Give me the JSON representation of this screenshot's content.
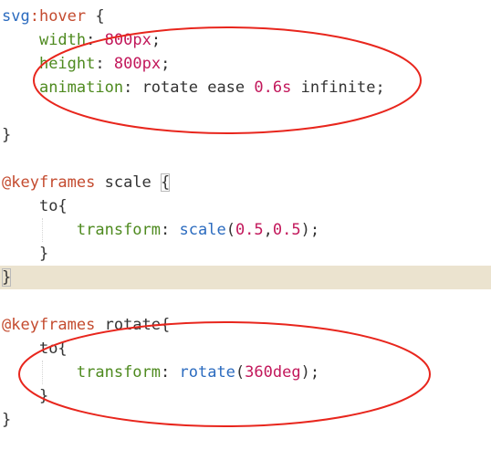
{
  "editor": {
    "lines": [
      {
        "tokens": [
          {
            "t": "svg",
            "c": "sel"
          },
          {
            "t": ":hover",
            "c": "pseudo"
          },
          {
            "t": " {",
            "c": "brace"
          }
        ]
      },
      {
        "tokens": [
          {
            "t": "    "
          },
          {
            "t": "width",
            "c": "prop"
          },
          {
            "t": ": ",
            "c": "punc"
          },
          {
            "t": "800",
            "c": "num"
          },
          {
            "t": "px",
            "c": "unit"
          },
          {
            "t": ";",
            "c": "punc"
          }
        ]
      },
      {
        "tokens": [
          {
            "t": "    "
          },
          {
            "t": "height",
            "c": "prop"
          },
          {
            "t": ": ",
            "c": "punc"
          },
          {
            "t": "800",
            "c": "num"
          },
          {
            "t": "px",
            "c": "unit"
          },
          {
            "t": ";",
            "c": "punc"
          }
        ]
      },
      {
        "tokens": [
          {
            "t": "    "
          },
          {
            "t": "animation",
            "c": "prop"
          },
          {
            "t": ": ",
            "c": "punc"
          },
          {
            "t": "rotate ease ",
            "c": "val"
          },
          {
            "t": "0.6",
            "c": "num"
          },
          {
            "t": "s",
            "c": "unit"
          },
          {
            "t": " infinite;",
            "c": "val"
          }
        ]
      },
      {
        "tokens": []
      },
      {
        "tokens": [
          {
            "t": "}",
            "c": "brace"
          }
        ]
      },
      {
        "tokens": []
      },
      {
        "tokens": [
          {
            "t": "@keyframes",
            "c": "at"
          },
          {
            "t": " scale ",
            "c": "ident"
          },
          {
            "t": "{",
            "c": "brace",
            "match": true
          }
        ]
      },
      {
        "tokens": [
          {
            "t": "    "
          },
          {
            "t": "to{",
            "c": "ident"
          }
        ]
      },
      {
        "tokens": [
          {
            "t": "        "
          },
          {
            "t": "transform",
            "c": "prop"
          },
          {
            "t": ": ",
            "c": "punc"
          },
          {
            "t": "scale",
            "c": "fn"
          },
          {
            "t": "(",
            "c": "punc"
          },
          {
            "t": "0.5",
            "c": "num"
          },
          {
            "t": ",",
            "c": "punc"
          },
          {
            "t": "0.5",
            "c": "num"
          },
          {
            "t": ");",
            "c": "punc"
          }
        ]
      },
      {
        "tokens": [
          {
            "t": "    "
          },
          {
            "t": "}",
            "c": "brace"
          }
        ]
      },
      {
        "tokens": [
          {
            "t": "}",
            "c": "brace",
            "match": true
          }
        ],
        "current": true
      },
      {
        "tokens": []
      },
      {
        "tokens": [
          {
            "t": "@keyframes",
            "c": "at"
          },
          {
            "t": " rotate{",
            "c": "ident"
          }
        ]
      },
      {
        "tokens": [
          {
            "t": "    "
          },
          {
            "t": "to{",
            "c": "ident"
          }
        ]
      },
      {
        "tokens": [
          {
            "t": "        "
          },
          {
            "t": "transform",
            "c": "prop"
          },
          {
            "t": ": ",
            "c": "punc"
          },
          {
            "t": "rotate",
            "c": "fn"
          },
          {
            "t": "(",
            "c": "punc"
          },
          {
            "t": "360",
            "c": "num"
          },
          {
            "t": "deg",
            "c": "unit"
          },
          {
            "t": ");",
            "c": "punc"
          }
        ]
      },
      {
        "tokens": [
          {
            "t": "    "
          },
          {
            "t": "}",
            "c": "brace"
          }
        ]
      },
      {
        "tokens": [
          {
            "t": "}",
            "c": "brace"
          }
        ]
      }
    ],
    "annotation_color": "#e8261d"
  }
}
